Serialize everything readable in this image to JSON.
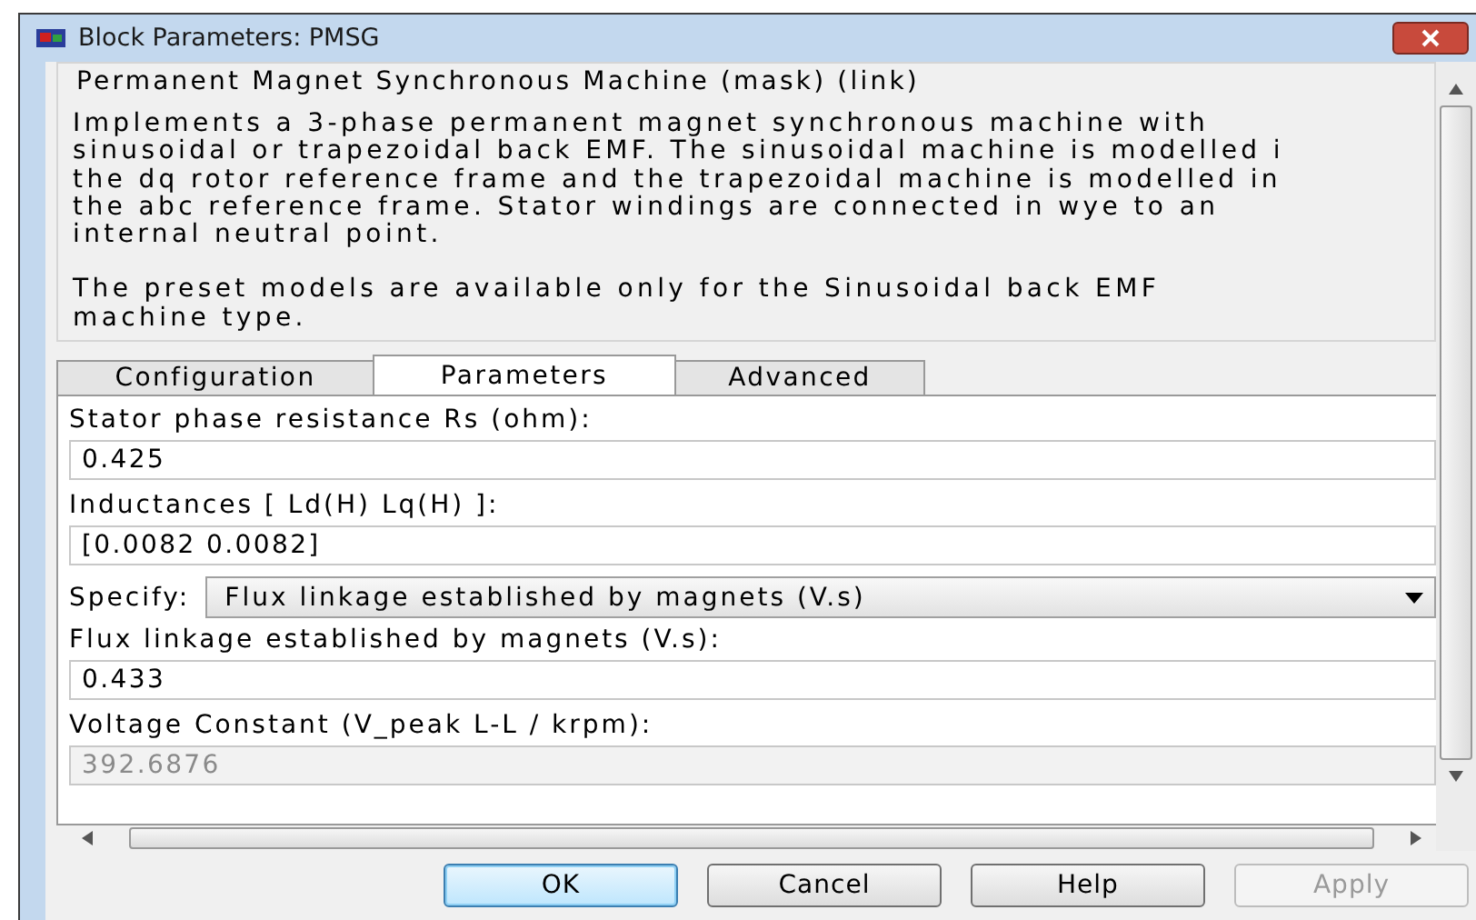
{
  "window": {
    "title": "Block Parameters: PMSG"
  },
  "header": "Permanent Magnet Synchronous Machine (mask) (link)",
  "description_lines": [
    "Implements a 3-phase permanent magnet synchronous machine with",
    "sinusoidal or trapezoidal back EMF. The sinusoidal machine is modelled i",
    "the dq rotor reference frame and the trapezoidal machine is modelled in",
    "the abc reference frame. Stator windings are connected in wye to an",
    "internal neutral point."
  ],
  "note_lines": [
    "The preset models are available only for the Sinusoidal back EMF",
    "machine type."
  ],
  "tabs": [
    {
      "label": "Configuration",
      "selected": false
    },
    {
      "label": "Parameters",
      "selected": true
    },
    {
      "label": "Advanced",
      "selected": false
    }
  ],
  "parameters": [
    {
      "kind": "field",
      "label": "Stator phase resistance Rs (ohm):",
      "value": "0.425",
      "disabled": false
    },
    {
      "kind": "field",
      "label": "Inductances [ Ld(H) Lq(H) ]:",
      "value": "[0.0082 0.0082]",
      "disabled": false
    },
    {
      "kind": "select",
      "label": "Specify:",
      "value": "Flux linkage established by magnets (V.s)"
    },
    {
      "kind": "field",
      "label": "Flux linkage established by magnets (V.s):",
      "value": "0.433",
      "disabled": false
    },
    {
      "kind": "field",
      "label": "Voltage Constant (V_peak L-L / krpm):",
      "value": "392.6876",
      "disabled": true
    }
  ],
  "buttons": [
    {
      "label": "OK",
      "default": true,
      "disabled": false
    },
    {
      "label": "Cancel",
      "default": false,
      "disabled": false
    },
    {
      "label": "Help",
      "default": false,
      "disabled": false
    },
    {
      "label": "Apply",
      "default": false,
      "disabled": true
    }
  ]
}
